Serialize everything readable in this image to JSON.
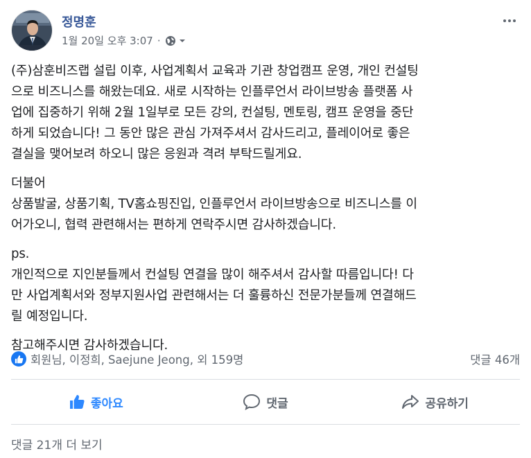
{
  "post": {
    "author": "정명훈",
    "timestamp": "1월 20일 오후 3:07",
    "privacy_icon": "globe-icon",
    "paragraphs": [
      "(주)삼훈비즈랩 설립 이후, 사업계획서 교육과 기관 창업캠프 운영, 개인 컨설팅\n으로 비즈니스를 해왔는데요. 새로 시작하는 인플루언서 라이브방송 플랫폼 사\n업에 집중하기 위해 2월 1일부로 모든 강의, 컨설팅, 멘토링, 캠프 운영을 중단\n하게 되었습니다! 그 동안 많은 관심 가져주셔서 감사드리고, 플레이어로 좋은\n결실을 맺어보려 하오니 많은 응원과 격려 부탁드릴게요.",
      "더불어\n상품발굴, 상품기획, TV홈쇼핑진입, 인플루언서 라이브방송으로 비즈니스를 이\n어가오니, 협력 관련해서는 편하게 연락주시면 감사하겠습니다.",
      "ps.\n개인적으로 지인분들께서 컨설팅 연결을 많이 해주셔서 감사할 따름입니다! 다\n만 사업계획서와 정부지원사업 관련해서는 더 훌륭하신 전문가분들께 연결해드\n릴 예정입니다.",
      "참고해주시면 감사하겠습니다."
    ]
  },
  "reactions": {
    "summary": "회원님, 이정희, Saejune Jeong, 외 159명",
    "comments": "댓글 46개"
  },
  "actions": {
    "like": "좋아요",
    "comment": "댓글",
    "share": "공유하기"
  },
  "footer": {
    "view_more": "댓글 21개 더 보기"
  },
  "colors": {
    "accent": "#2d88ff",
    "author_link": "#385898",
    "secondary_text": "#606770"
  }
}
